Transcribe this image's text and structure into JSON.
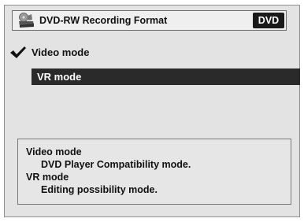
{
  "title_bar": {
    "icon": "dvd-recorder-icon",
    "title": "DVD-RW Recording Format",
    "badge": "DVD"
  },
  "menu": {
    "items": [
      {
        "label": "Video mode",
        "checked": true,
        "highlighted": false
      },
      {
        "label": "VR mode",
        "checked": false,
        "highlighted": true
      }
    ],
    "check_icon": "checkmark-icon"
  },
  "info": {
    "lines": [
      "Video mode",
      "DVD Player Compatibility mode.",
      "VR mode",
      "Editing possibility mode."
    ]
  },
  "colors": {
    "background": "#e3e3e3",
    "highlight": "#2a2a2a",
    "badge": "#1a1a1a"
  }
}
